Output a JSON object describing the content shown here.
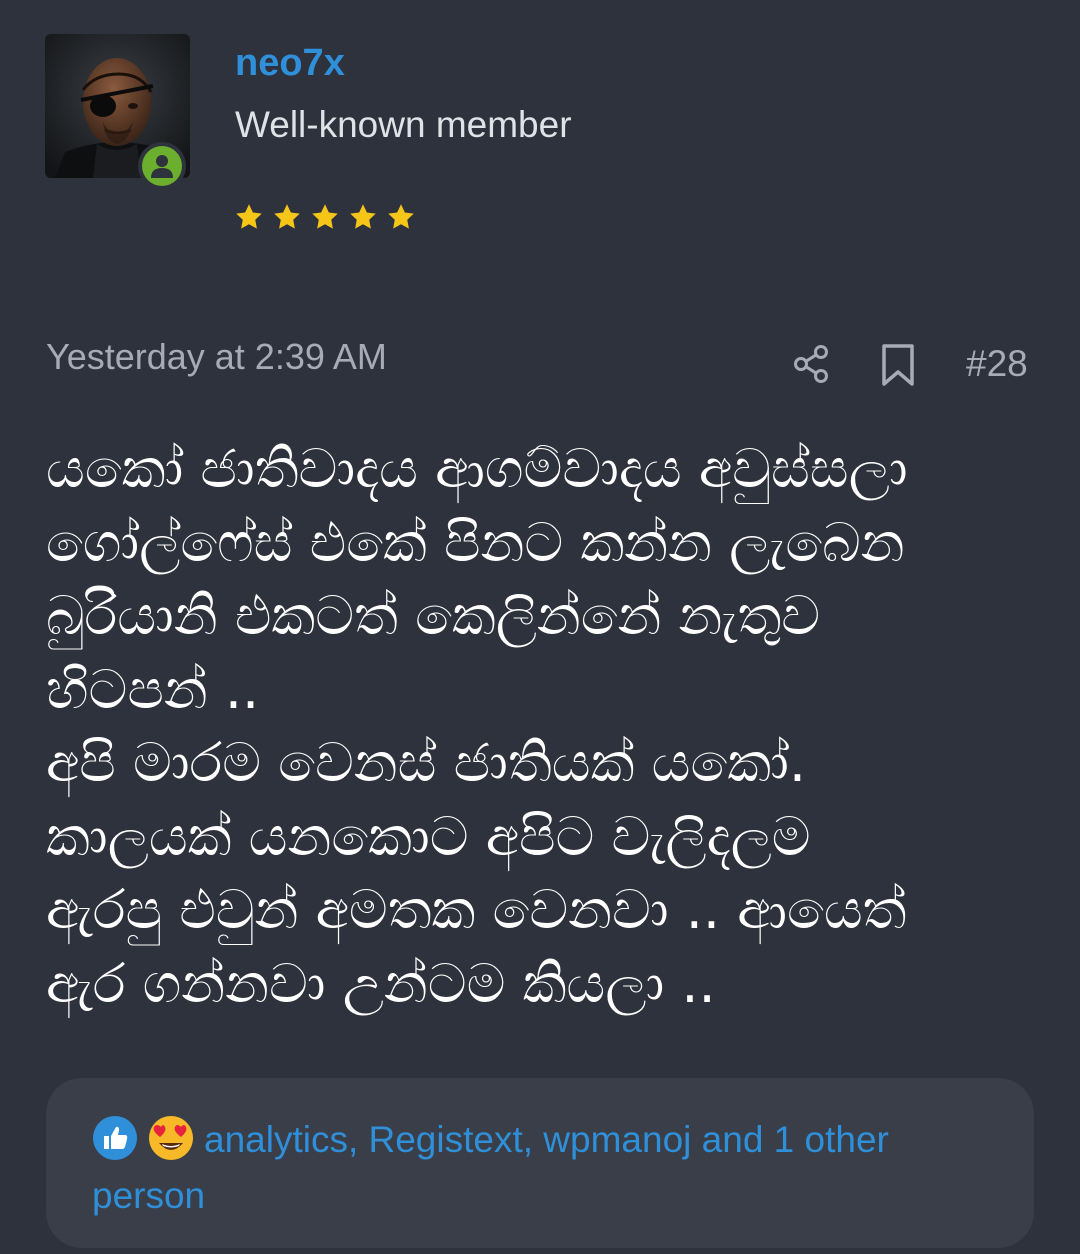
{
  "user": {
    "username": "neo7x",
    "title": "Well-known member",
    "avatar": "avatar",
    "online_status": "online",
    "rating_stars": 5
  },
  "post": {
    "timestamp": "Yesterday at 2:39 AM",
    "number": "#28",
    "lines": [
      "යකෝ ජාතිවාදය ආගම්වාදය අවුස්සලා",
      "ගෝල්ෆේස් එකේ පිනට කන්න ලැබෙන",
      "බුරියානි එකටත් කෙලින්නේ නැතුව",
      "හිටපන් ..",
      "අපි මාරම වෙනස් ජාතියක් යකෝ.",
      "කාලයක් යනකොට අපිට වැලිදලම",
      "ඇරපු එවුන් අමතක වෙනවා .. ආයෙත්",
      "ඇර ගන්නවා උන්ටම කියලා .."
    ]
  },
  "actions": {
    "share_icon": "share-icon",
    "bookmark_icon": "bookmark-icon"
  },
  "reactions": {
    "icons": [
      "like-icon",
      "love-eyes-emoji-icon"
    ],
    "text": "analytics, Registext, wpmanoj and 1 other person"
  },
  "colors": {
    "background": "#2e323c",
    "accent": "#2f8fd8",
    "star": "#f5c518",
    "online": "#6cae2e",
    "reaction_bar": "#3a3e48"
  }
}
